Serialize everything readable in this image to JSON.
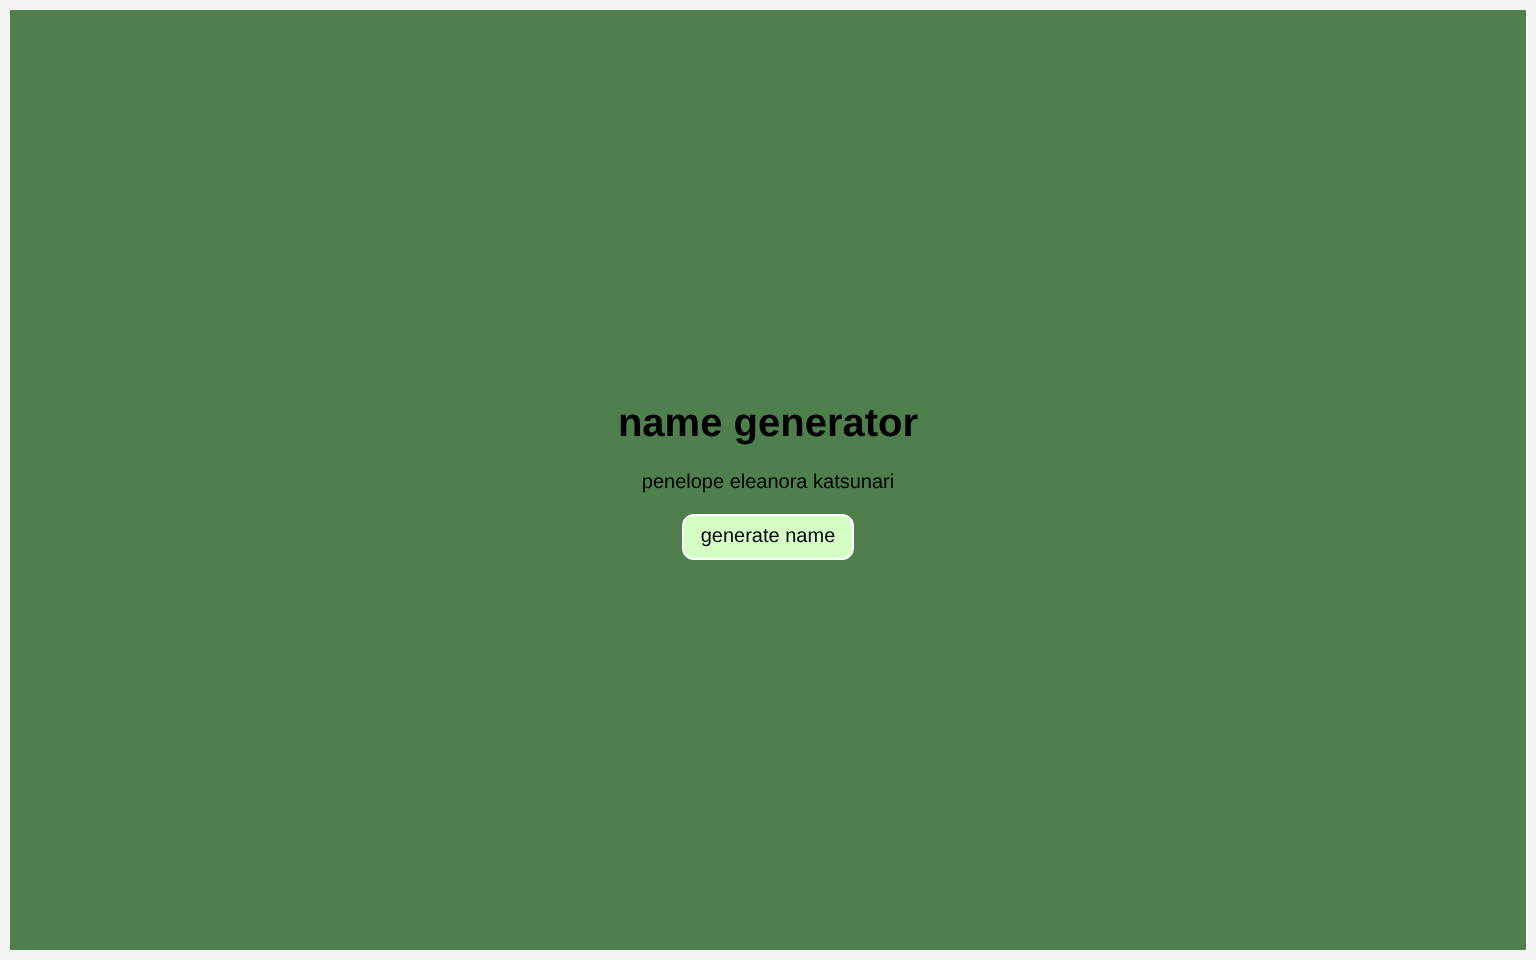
{
  "title": "name generator",
  "name": "penelope eleanora katsunari",
  "button": "generate name"
}
